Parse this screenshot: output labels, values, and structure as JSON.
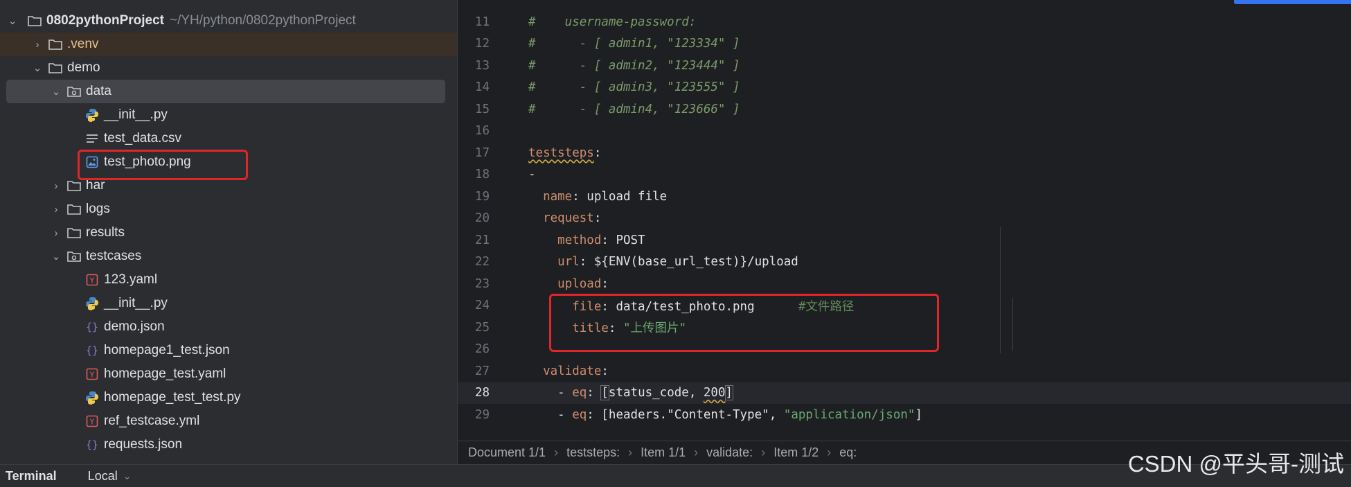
{
  "project": {
    "root_name": "0802pythonProject",
    "root_path": "~/YH/python/0802pythonProject",
    "items": [
      {
        "label": ".venv",
        "icon": "folder-icon"
      },
      {
        "label": "demo",
        "icon": "folder-icon"
      },
      {
        "label": "data",
        "icon": "package-folder-icon"
      },
      {
        "label": "__init__.py",
        "icon": "python-icon"
      },
      {
        "label": "test_data.csv",
        "icon": "text-file-icon"
      },
      {
        "label": "test_photo.png",
        "icon": "image-icon"
      },
      {
        "label": "har",
        "icon": "folder-icon"
      },
      {
        "label": "logs",
        "icon": "folder-icon"
      },
      {
        "label": "results",
        "icon": "folder-icon"
      },
      {
        "label": "testcases",
        "icon": "package-folder-icon"
      },
      {
        "label": "123.yaml",
        "icon": "yaml-icon"
      },
      {
        "label": "__init__.py",
        "icon": "python-icon"
      },
      {
        "label": "demo.json",
        "icon": "json-icon"
      },
      {
        "label": "homepage1_test.json",
        "icon": "json-icon"
      },
      {
        "label": "homepage_test.yaml",
        "icon": "yaml-icon"
      },
      {
        "label": "homepage_test_test.py",
        "icon": "python-icon"
      },
      {
        "label": "ref_testcase.yml",
        "icon": "yaml-icon"
      },
      {
        "label": "requests.json",
        "icon": "json-icon"
      }
    ]
  },
  "editor": {
    "lines": [
      {
        "n": "11",
        "parts": [
          [
            "cmt",
            "#    username-password:"
          ]
        ]
      },
      {
        "n": "12",
        "parts": [
          [
            "cmt",
            "#      - [ admin1, \"123334\" ]"
          ]
        ]
      },
      {
        "n": "13",
        "parts": [
          [
            "cmt",
            "#      - [ admin2, \"123444\" ]"
          ]
        ]
      },
      {
        "n": "14",
        "parts": [
          [
            "cmt",
            "#      - [ admin3, \"123555\" ]"
          ]
        ]
      },
      {
        "n": "15",
        "parts": [
          [
            "cmt",
            "#      - [ admin4, \"123666\" ]"
          ]
        ]
      },
      {
        "n": "16",
        "parts": []
      },
      {
        "n": "17",
        "parts": [
          [
            "key wavy",
            "teststeps"
          ],
          [
            "txt",
            ":"
          ]
        ]
      },
      {
        "n": "18",
        "parts": [
          [
            "txt",
            "-"
          ]
        ]
      },
      {
        "n": "19",
        "parts": [
          [
            "txt",
            "  "
          ],
          [
            "key",
            "name"
          ],
          [
            "txt",
            ": upload file"
          ]
        ]
      },
      {
        "n": "20",
        "parts": [
          [
            "txt",
            "  "
          ],
          [
            "key",
            "request"
          ],
          [
            "txt",
            ":"
          ]
        ]
      },
      {
        "n": "21",
        "parts": [
          [
            "txt",
            "    "
          ],
          [
            "key",
            "method"
          ],
          [
            "txt",
            ": POST"
          ]
        ]
      },
      {
        "n": "22",
        "parts": [
          [
            "txt",
            "    "
          ],
          [
            "key",
            "url"
          ],
          [
            "txt",
            ": ${ENV(base_url_test)}/upload"
          ]
        ]
      },
      {
        "n": "23",
        "parts": [
          [
            "txt",
            "    "
          ],
          [
            "key",
            "upload"
          ],
          [
            "txt",
            ":"
          ]
        ]
      },
      {
        "n": "24",
        "parts": [
          [
            "txt",
            "      "
          ],
          [
            "key",
            "file"
          ],
          [
            "txt",
            ": data/test_photo.png      "
          ],
          [
            "cmt-plain",
            "#文件路径"
          ]
        ]
      },
      {
        "n": "25",
        "parts": [
          [
            "txt",
            "      "
          ],
          [
            "key",
            "title"
          ],
          [
            "txt",
            ": "
          ],
          [
            "str",
            "\"上传图片\""
          ]
        ]
      },
      {
        "n": "26",
        "parts": []
      },
      {
        "n": "27",
        "parts": [
          [
            "txt",
            "  "
          ],
          [
            "key",
            "validate"
          ],
          [
            "txt",
            ":"
          ]
        ]
      },
      {
        "n": "28",
        "parts": [
          [
            "txt",
            "    - "
          ],
          [
            "key",
            "eq"
          ],
          [
            "txt",
            ": "
          ],
          [
            "txt bracket",
            "["
          ],
          [
            "txt",
            "status_code, "
          ],
          [
            "txt wavy",
            "200"
          ],
          [
            "txt bracket",
            "]"
          ]
        ]
      },
      {
        "n": "29",
        "parts": [
          [
            "txt",
            "    - "
          ],
          [
            "key",
            "eq"
          ],
          [
            "txt",
            ": [headers.\"Content-Type\", "
          ],
          [
            "str",
            "\"application/json\""
          ],
          [
            "txt",
            "]"
          ]
        ]
      }
    ]
  },
  "breadcrumb": [
    "Document 1/1",
    "teststeps:",
    "Item 1/1",
    "validate:",
    "Item 1/2",
    "eq:"
  ],
  "bottom": {
    "terminal": "Terminal",
    "local": "Local"
  },
  "watermark": "CSDN @平头哥-测试"
}
